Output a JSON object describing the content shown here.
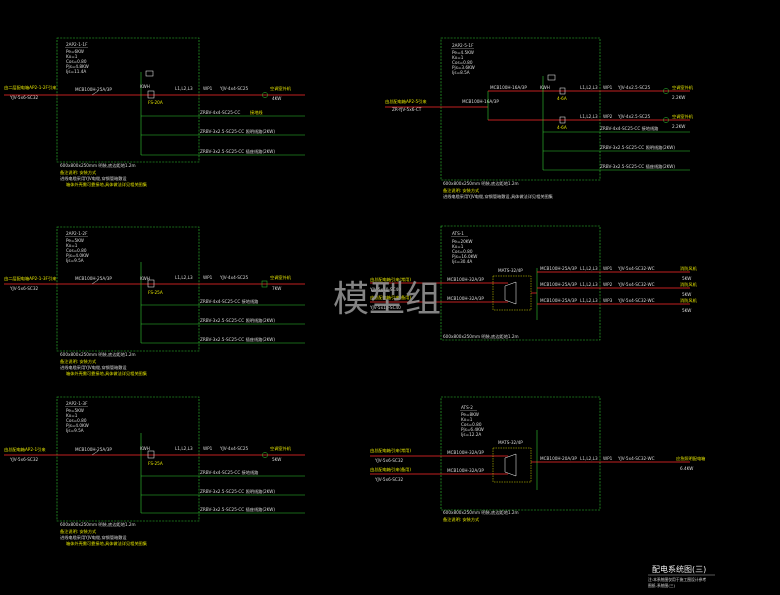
{
  "watermark": "模型组",
  "drawing_title": "配电系统图(三)",
  "drawing_notes": [
    "注:本系统图仅用于施工图设计参考",
    "图纸-系统图(三)"
  ],
  "colors": {
    "background": "#000000",
    "frame": "#33cc33",
    "busbar": "#ff2b2b",
    "text": "#dcdcdc",
    "yellow_text": "#e6e600"
  },
  "panels": {
    "p1": {
      "name": "2AP2-1-1F",
      "params": [
        "Pe=6KW",
        "Kx=1",
        "Cos=0.80",
        "Pjs=4.8KW",
        "Ijs=11.4A"
      ],
      "incoming_label": "由二层配电箱AP2-1-2F引来",
      "incoming_cable": "YJV-5x6-SC32",
      "main_breaker": "MCB100H-25A/3P",
      "meter": "KWH",
      "ct": "CT 25/5A",
      "fuse": "FS-20A",
      "outgoing": [
        {
          "breaker": "L1,L2,L3",
          "circuit": "WP1",
          "cable": "YJV-4x4-SC25",
          "load": "空调室外机",
          "kw": "4KW"
        },
        {
          "breaker": "",
          "circuit": "",
          "cable": "ZRBV-4x4-SC25-CC",
          "load": "接地线",
          "kw": ""
        },
        {
          "breaker": "",
          "circuit": "",
          "cable": "ZRBV-3x2.5-SC25-CC 照明线路(2KW)",
          "load": "",
          "kw": ""
        },
        {
          "breaker": "",
          "circuit": "",
          "cable": "ZRBV-3x2.5-SC25-CC 插座线路(2KW)",
          "load": "",
          "kw": ""
        }
      ],
      "enclosure": "600x800x250mm 明装,底边距地1.2m",
      "notes": [
        "备注说明: 安装方式",
        "进线电缆采用YJV电缆,穿钢管暗敷设",
        "箱体外壳需可靠接地,具体做法详见相关图集"
      ]
    },
    "p2": {
      "name": "2AP2-1-2F",
      "params": [
        "Pe=5KW",
        "Kx=1",
        "Cos=0.80",
        "Pjs=4.0KW",
        "Ijs=9.5A"
      ],
      "incoming_label": "由二层配电箱AP2-1-3F引来",
      "incoming_cable": "YJV-5x6-SC32",
      "main_breaker": "MCB100H-25A/3P",
      "meter": "KWH",
      "fuse": "FS-25A",
      "outgoing": [
        {
          "breaker": "L1,L2,L3",
          "circuit": "WP1",
          "cable": "YJV-4x4-SC25",
          "load": "空调室外机",
          "kw": "7KW"
        },
        {
          "breaker": "",
          "circuit": "",
          "cable": "ZRBV-4x4-SC25-CC 接地线路",
          "load": "",
          "kw": ""
        },
        {
          "breaker": "",
          "circuit": "",
          "cable": "ZRBV-3x2.5-SC25-CC 照明线路(2KW)",
          "load": "",
          "kw": ""
        },
        {
          "breaker": "",
          "circuit": "",
          "cable": "ZRBV-3x2.5-SC25-CC 插座线路(2KW)",
          "load": "",
          "kw": ""
        }
      ],
      "enclosure": "600x800x250mm 明装,底边距地1.2m",
      "notes": [
        "备注说明: 安装方式",
        "进线电缆采用YJV电缆,穿钢管暗敷设",
        "箱体外壳需可靠接地,具体做法详见相关图集"
      ]
    },
    "p3": {
      "name": "2AP2-1-3F",
      "params": [
        "Pe=5KW",
        "Kx=1",
        "Cos=0.80",
        "Pjs=4.0KW",
        "Ijs=9.5A"
      ],
      "incoming_label": "由总配电箱AP2-1引来",
      "incoming_cable": "YJV-5x6-SC32",
      "main_breaker": "MCB100H-25A/3P",
      "meter": "KWH",
      "fuse": "FS-25A",
      "outgoing": [
        {
          "breaker": "L1,L2,L3",
          "circuit": "WP1",
          "cable": "YJV-4x4-SC25",
          "load": "空调室外机",
          "kw": "5KW"
        },
        {
          "breaker": "",
          "circuit": "",
          "cable": "ZRBV-4x4-SC25-CC 接地线路",
          "load": "",
          "kw": ""
        },
        {
          "breaker": "",
          "circuit": "",
          "cable": "ZRBV-3x2.5-SC25-CC 照明线路(2KW)",
          "load": "",
          "kw": ""
        },
        {
          "breaker": "",
          "circuit": "",
          "cable": "ZRBV-3x2.5-SC25-CC 插座线路(2KW)",
          "load": "",
          "kw": ""
        }
      ],
      "enclosure": "600x800x250mm 明装,底边距地1.2m",
      "notes": [
        "备注说明: 安装方式",
        "进线电缆采用YJV电缆,穿钢管暗敷设",
        "箱体外壳需可靠接地,具体做法详见相关图集"
      ]
    },
    "p4": {
      "name": "2AP2-5-1F",
      "params": [
        "Pe=4.5KW",
        "Kx=1",
        "Cos=0.80",
        "Pjs=3.6KW",
        "Ijs=8.5A"
      ],
      "incoming_label": "由总配电箱AP2-5引来",
      "incoming_cable": "ZR-YJV-5x6-CT",
      "main_breaker": "MCB100H-16A/3P",
      "second_breaker": "MCB100H-16A/3P",
      "meter": "KWH",
      "ct_labels": [
        "4-6A",
        "4-6A"
      ],
      "outgoing": [
        {
          "breaker": "L1,L2,L3",
          "circuit": "WP1",
          "cable": "YJV-4x2.5-SC25",
          "load": "空调室外机",
          "kw": "2.2KW"
        },
        {
          "breaker": "L1,L2,L3",
          "circuit": "WP2",
          "cable": "YJV-4x2.5-SC25",
          "load": "空调室外机",
          "kw": "2.2KW"
        },
        {
          "breaker": "",
          "circuit": "",
          "cable": "ZRBV-4x4-SC25-CC 接地线路",
          "load": "",
          "kw": ""
        },
        {
          "breaker": "",
          "circuit": "",
          "cable": "ZRBV-3x2.5-SC25-CC 照明线路(2KW)",
          "load": "",
          "kw": ""
        },
        {
          "breaker": "",
          "circuit": "",
          "cable": "ZRBV-3x2.5-SC25-CC 插座线路(2KW)",
          "load": "",
          "kw": ""
        }
      ],
      "enclosure": "600x800x250mm 明装,底边距地1.2m",
      "notes": [
        "备注说明: 安装方式",
        "进线电缆采用YJV电缆,穿钢管暗敷设,具体做法详见相关图集"
      ]
    },
    "p5": {
      "name": "ATS-1",
      "params": [
        "Pe=20KW",
        "Kx=1",
        "Cos=0.80",
        "Pjs=16.0KW",
        "Ijs=30.4A"
      ],
      "incoming": [
        {
          "label": "由总配电箱引来(常用)",
          "cable": "YJV-5x10-SC40"
        },
        {
          "label": "由总配电箱引来(备用)",
          "cable": "YJV-5x10-SC40"
        }
      ],
      "ats_label": "MATS-32/4P",
      "in_breakers": [
        "MCB100H-32A/3P",
        "MCB100H-32A/3P"
      ],
      "outgoing": [
        {
          "breaker": "MCB100H-25A/3P",
          "phase": "L1,L2,L3",
          "circuit": "WP1",
          "cable": "YJV-5x4-SC32-WC",
          "load": "消防风机",
          "kw": "5KW"
        },
        {
          "breaker": "MCB100H-25A/3P",
          "phase": "L1,L2,L3",
          "circuit": "WP2",
          "cable": "YJV-5x4-SC32-WC",
          "load": "消防风机",
          "kw": "5KW"
        },
        {
          "breaker": "MCB100H-25A/3P",
          "phase": "L1,L2,L3",
          "circuit": "WP3",
          "cable": "YJV-5x4-SC32-WC",
          "load": "消防风机",
          "kw": "5KW"
        }
      ],
      "enclosure": "600x800x250mm 明装,底边距地1.2m"
    },
    "p6": {
      "name": "ATS-2",
      "params": [
        "Pe=8KW",
        "Kx=1",
        "Cos=0.80",
        "Pjs=6.4KW",
        "Ijs=12.2A"
      ],
      "incoming": [
        {
          "label": "由总配电箱引来(常用)",
          "cable": "YJV-5x6-SC32"
        },
        {
          "label": "由总配电箱引来(备用)",
          "cable": "YJV-5x6-SC32"
        }
      ],
      "ats_label": "MATS-32/4P",
      "in_breakers": [
        "MCB100H-32A/3P",
        "MCB100H-32A/3P"
      ],
      "outgoing": [
        {
          "breaker": "MCB100H-20A/3P",
          "phase": "L1,L2,L3",
          "circuit": "WP1",
          "cable": "YJV-5x4-SC32-WC",
          "load": "应急照明配电箱",
          "kw": "6.4KW"
        }
      ],
      "enclosure": "600x800x250mm 明装,底边距地1.2m",
      "notes": [
        "备注说明: 安装方式"
      ]
    }
  }
}
